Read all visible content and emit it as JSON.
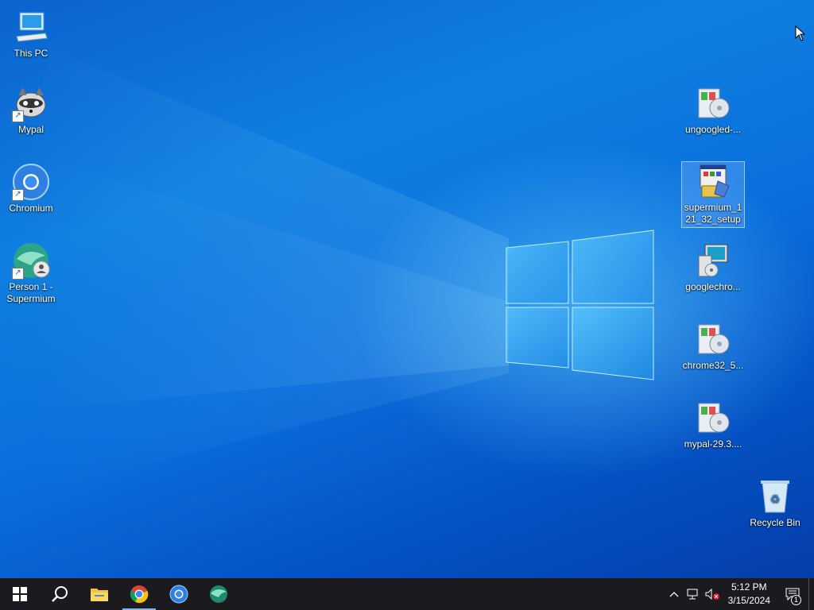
{
  "desktop": {
    "left_icons": [
      {
        "label": "This PC",
        "icon": "computer-icon"
      },
      {
        "label": "Mypal",
        "icon": "raccoon-icon"
      },
      {
        "label": "Chromium",
        "icon": "chromium-icon"
      },
      {
        "label": "Person 1 - Supermium",
        "icon": "supermium-profile-icon"
      }
    ],
    "right_icons": [
      {
        "label": "ungoogled-...",
        "icon": "installer-icon"
      },
      {
        "label": "supermium_121_32_setup",
        "icon": "setup-icon",
        "selected": true
      },
      {
        "label": "googlechro...",
        "icon": "setup-computer-icon"
      },
      {
        "label": "chrome32_5...",
        "icon": "installer-icon"
      },
      {
        "label": "mypal-29.3....",
        "icon": "installer-icon"
      }
    ],
    "recycle_bin": {
      "label": "Recycle Bin",
      "icon": "recycle-bin-icon"
    }
  },
  "taskbar": {
    "apps": [
      "start-icon",
      "search-icon",
      "file-explorer-icon",
      "chrome-icon",
      "chromium-icon",
      "supermium-icon"
    ],
    "clock": {
      "time": "5:12 PM",
      "date": "3/15/2024"
    },
    "notification_count": "1"
  },
  "colors": {
    "taskbar": "#1b1b1f",
    "desktop": "#0a6fdd",
    "accent": "#76b9ed"
  }
}
